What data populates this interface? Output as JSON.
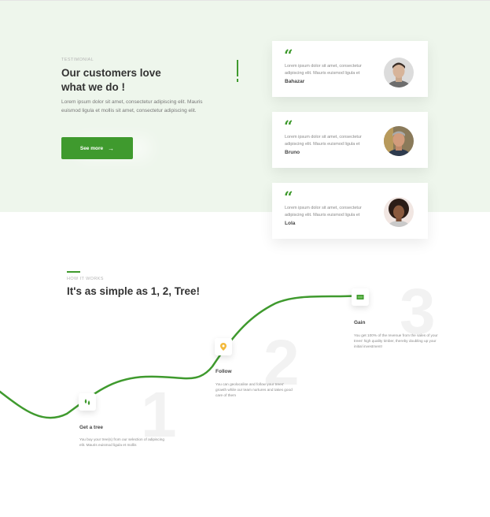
{
  "testimonial": {
    "eyebrow": "TESTIMONIAL",
    "title_line1": "Our customers love",
    "title_line2": "what we do !",
    "lead": "Lorem ipsum dolor sit amet, consectetur adipiscing elit. Mauris euismod ligula et mollis sit amet, consectetur adipiscing elit.",
    "cta_label": "See more",
    "cta_arrow": "→",
    "quote_mark": "“",
    "cards": [
      {
        "text": "Lorem ipsum dolor sit amet, consectetur adipiscing elit. Mauris euismod ligula et",
        "name": "Bahazar"
      },
      {
        "text": "Lorem ipsum dolor sit amet, consectetur adipiscing elit. Mauris euismod ligula et",
        "name": "Bruno"
      },
      {
        "text": "Lorem ipsum dolor sit amet, consectetur adipiscing elit. Mauris euismod ligula et",
        "name": "Lola"
      }
    ]
  },
  "how": {
    "eyebrow": "HOW IT WORKS",
    "title": "It's as simple as 1, 2, Tree!",
    "steps": [
      {
        "number": "1",
        "icon": "drops-icon",
        "title": "Get a tree",
        "desc": "You buy your tree(s) from our selection of adipiscing elit. Mauris euismod ligula et mollis"
      },
      {
        "number": "2",
        "icon": "location-pin-icon",
        "title": "Follow",
        "desc": "You can geolocalise and follow your trees' growth while our team nurtures and takes good care of them"
      },
      {
        "number": "3",
        "icon": "money-icon",
        "title": "Gain",
        "desc": "You get 100% of the revenue from the sales of your trees' high quality timber, thereby doubling up your initial investment!"
      }
    ]
  },
  "colors": {
    "accent": "#3f9a2e",
    "hero_bg": "#eef6ec",
    "pin": "#f3b93a"
  }
}
